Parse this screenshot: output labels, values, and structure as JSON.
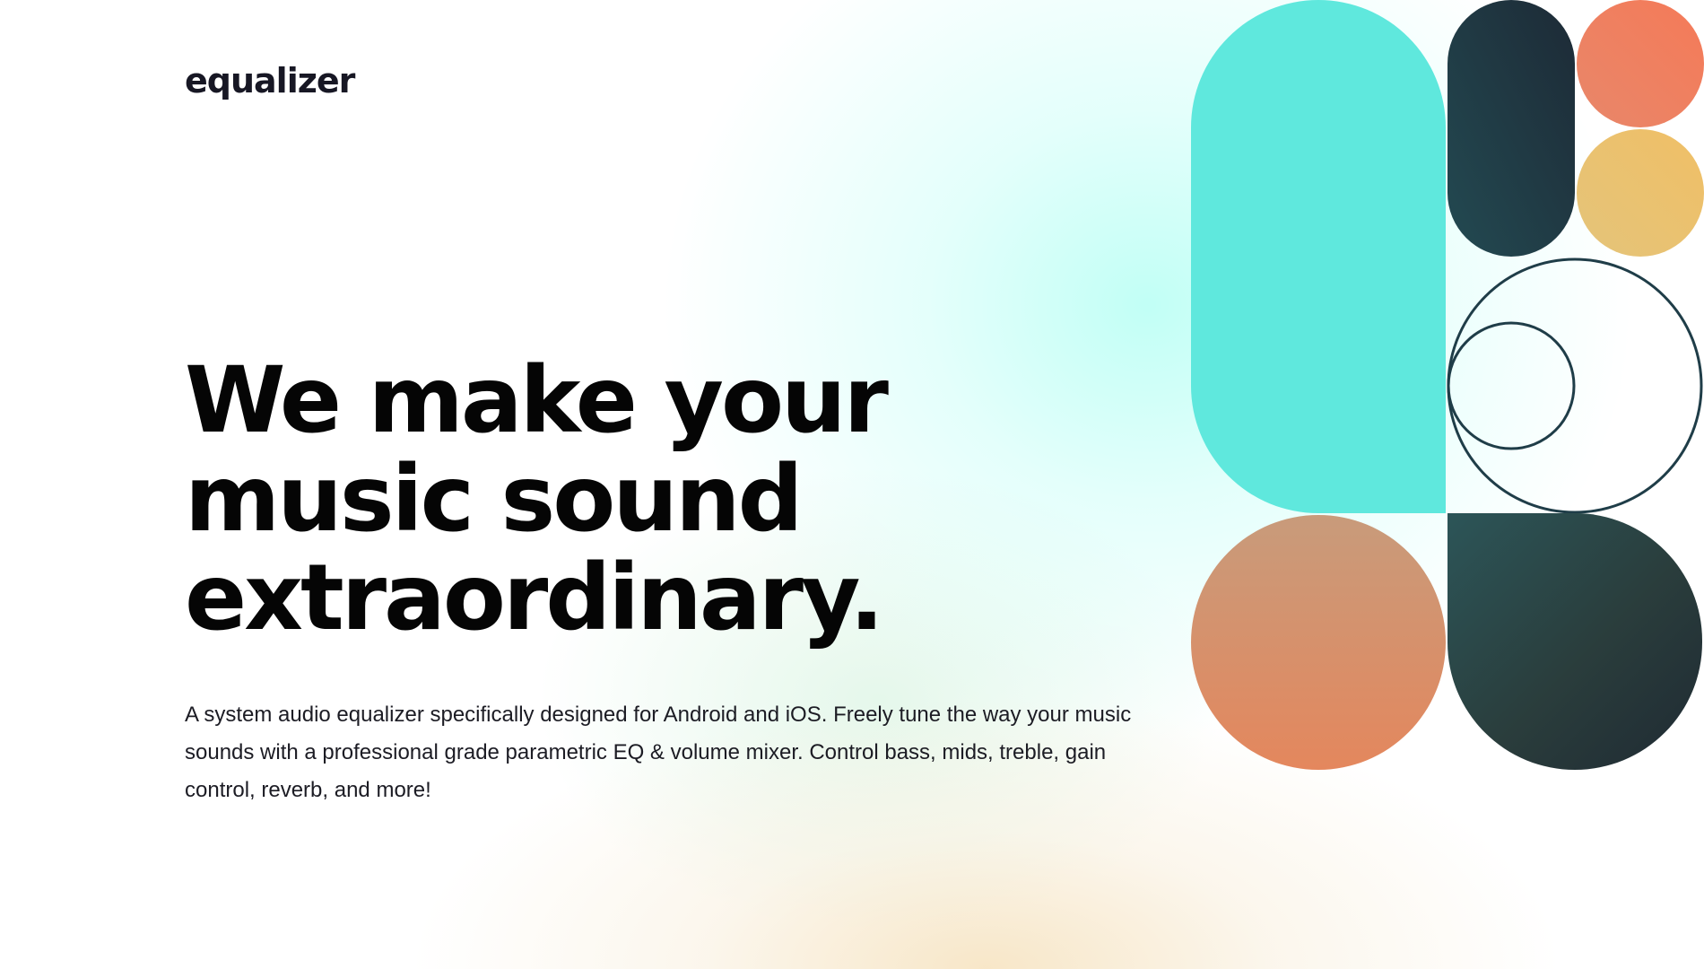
{
  "brand": {
    "logo_text": "equalizer"
  },
  "hero": {
    "headline_lines": [
      "We make your",
      "music sound",
      "extraordinary."
    ],
    "description": "A system audio equalizer specifically designed for Android and iOS. Freely tune the way your music sounds with a professional grade parametric EQ & volume mixer. Control bass, mids, treble, gain control, reverb, and more!"
  },
  "artwork": {
    "shapes": [
      {
        "name": "aqua-pill-shape",
        "color": "#5fe8dd"
      },
      {
        "name": "dark-capsule-shape",
        "color": "#1f3540"
      },
      {
        "name": "coral-circle-shape",
        "color": "#f27c5d"
      },
      {
        "name": "amber-circle-shape",
        "color": "#eac06c"
      },
      {
        "name": "ring-outline-shape",
        "color": "#1f3d48"
      },
      {
        "name": "peach-circle-shape",
        "color": "#d9916a"
      },
      {
        "name": "dark-quarter-shape",
        "color": "#263a3d"
      }
    ]
  },
  "colors": {
    "text": "#050505",
    "logo": "#171724",
    "accent_aqua": "#5fe8dd",
    "accent_coral": "#f27c5d",
    "accent_amber": "#eac06c",
    "accent_dark": "#1f3540"
  }
}
